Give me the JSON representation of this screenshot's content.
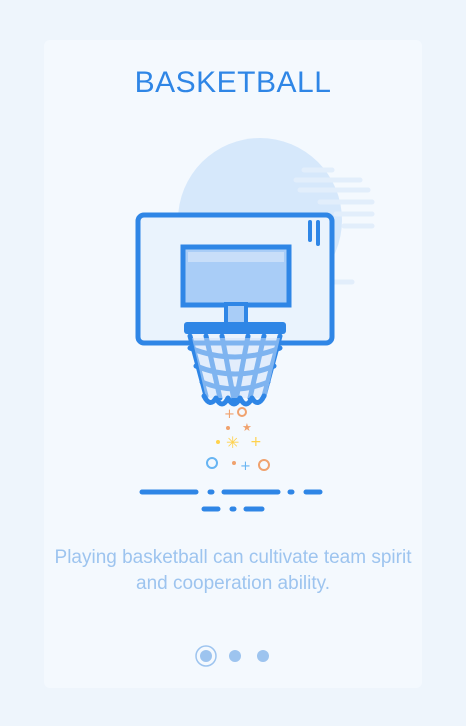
{
  "screen": {
    "title": "BASKETBALL",
    "description": "Playing basketball can cultivate team spirit and cooperation ability."
  },
  "pagination": {
    "total": 3,
    "active_index": 0
  },
  "colors": {
    "accent": "#2f86e6",
    "text_light": "#9dc4ef",
    "background": "#eef5fc",
    "card": "#f4f9fe"
  },
  "icons": {
    "illustration": "basketball-hoop-icon"
  }
}
